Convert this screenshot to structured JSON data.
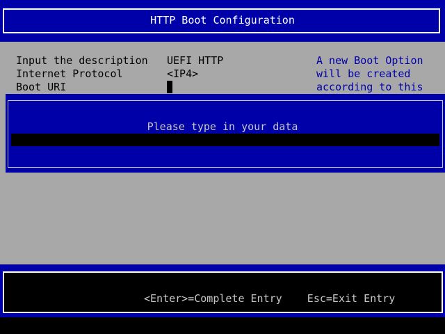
{
  "header": {
    "title": "HTTP Boot Configuration"
  },
  "form": {
    "rows": [
      {
        "label": "Input the description",
        "value": "UEFI HTTP"
      },
      {
        "label": "Internet Protocol",
        "value": "<IP4>"
      },
      {
        "label": "Boot URI",
        "value": ""
      }
    ]
  },
  "help": {
    "lines": [
      "A new Boot Option",
      "will be created",
      "according to this"
    ]
  },
  "popup": {
    "prompt": "Please type in your data",
    "input_value": ""
  },
  "footer": {
    "hint": "<Enter>=Complete Entry    Esc=Exit Entry"
  },
  "colors": {
    "blue": "#0000a8",
    "grey": "#a8a8a8",
    "white": "#ffffff",
    "black": "#000000",
    "light_grey": "#c8c8c8"
  }
}
